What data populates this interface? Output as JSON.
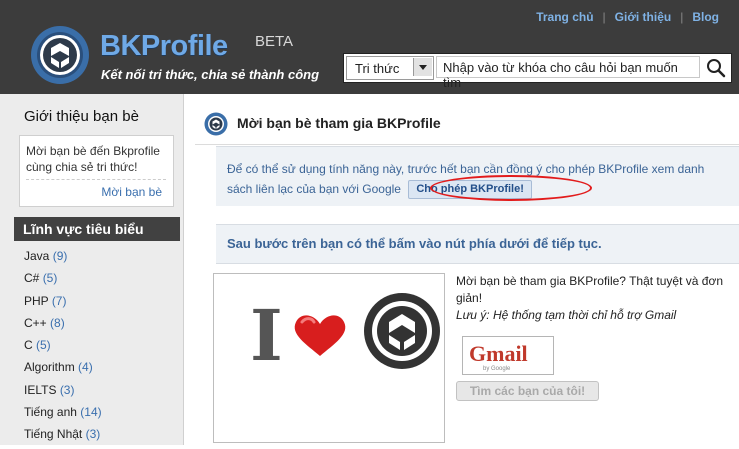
{
  "header": {
    "brand": "BKProfile",
    "beta": "BETA",
    "tagline": "Kết nối tri thức, chia sẻ thành công",
    "top_links": [
      "Trang chủ",
      "Giới thiệu",
      "Blog"
    ],
    "search": {
      "category": "Tri thức",
      "placeholder": "Nhập vào từ khóa cho câu hỏi bạn muốn tìm",
      "button_icon": "magnifier-icon"
    }
  },
  "sidebar": {
    "title": "Giới thiệu bạn bè",
    "invite_text": "Mời bạn bè đến Bkprofile cùng chia sẻ tri thức!",
    "invite_link": "Mời bạn bè",
    "categories_title": "Lĩnh vực tiêu biểu",
    "categories": [
      {
        "name": "Java",
        "count": "(9)"
      },
      {
        "name": "C#",
        "count": "(5)"
      },
      {
        "name": "PHP",
        "count": "(7)"
      },
      {
        "name": "C++",
        "count": "(8)"
      },
      {
        "name": "C",
        "count": "(5)"
      },
      {
        "name": "Algorithm",
        "count": "(4)"
      },
      {
        "name": "IELTS",
        "count": "(3)"
      },
      {
        "name": "Tiếng anh",
        "count": "(14)"
      },
      {
        "name": "Tiếng Nhật",
        "count": "(3)"
      }
    ]
  },
  "main": {
    "title": "Mời bạn bè tham gia BKProfile",
    "permission_text": "Để có thể sử dụng tính năng này, trước hết bạn cần đồng ý cho phép BKProfile xem danh sách liên lạc của bạn với Google",
    "allow_button": "Cho phép BKProfile!",
    "next_step_text": "Sau bước trên bạn có thể bấm vào nút phía dưới để tiếp tục.",
    "promo_line1": "Mời bạn bè tham gia BKProfile? Thật tuyệt và đơn giản!",
    "promo_note": "Lưu ý: Hệ thống tạm thời chỉ hỗ trợ Gmail",
    "gmail_logo_text": "Gmail",
    "gmail_by": "by Google",
    "find_button": "Tìm các bạn của tôi!",
    "promo_image_letter": "I"
  },
  "colors": {
    "header_bg": "#3c3c3c",
    "link_blue": "#7fb2e5",
    "panel_bg": "#eef2f6",
    "annotation_red": "#e21b1b"
  }
}
